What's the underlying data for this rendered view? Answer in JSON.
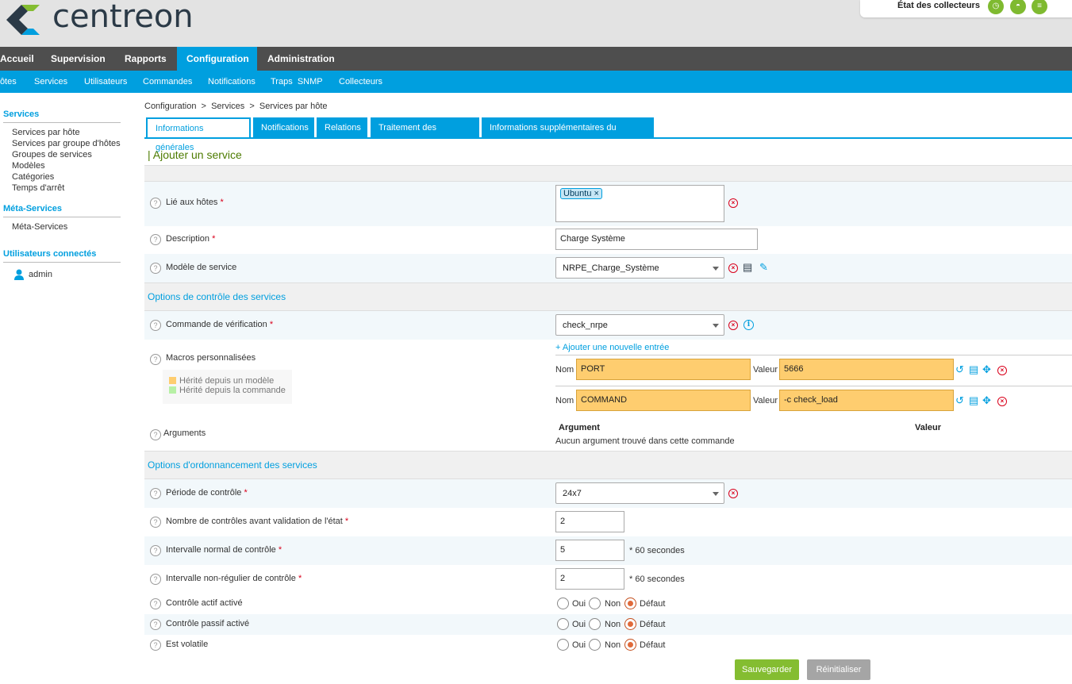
{
  "header": {
    "logo_text": "centreon",
    "collectors_label": "État des collecteurs"
  },
  "mainnav": [
    "Accueil",
    "Supervision",
    "Rapports",
    "Configuration",
    "Administration"
  ],
  "subnav": [
    "Hôtes",
    "Services",
    "Utilisateurs",
    "Commandes",
    "Notifications",
    "Traps  SNMP",
    "Collecteurs"
  ],
  "sidebar": {
    "services_title": "Services",
    "services_items": [
      "Services par hôte",
      "Services par groupe d'hôtes",
      "Groupes de services",
      "Modèles",
      "Catégories",
      "Temps d'arrêt"
    ],
    "meta_title": "Méta-Services",
    "meta_items": [
      "Méta-Services"
    ],
    "users_title": "Utilisateurs connectés",
    "user_name": "admin"
  },
  "breadcrumb": "Configuration  >  Services  >  Services par hôte",
  "tabs": [
    "Informations générales",
    "Notifications",
    "Relations",
    "Traitement des données",
    "Informations supplémentaires du service"
  ],
  "page_title": "| Ajouter un service",
  "form": {
    "hosts_label": "Lié aux hôtes",
    "hosts_tag": "Ubuntu",
    "description_label": "Description",
    "description_value": "Charge Système",
    "template_label": "Modèle de service",
    "template_value": "NRPE_Charge_Système",
    "section_control": "Options de contrôle des services",
    "check_cmd_label": "Commande de vérification",
    "check_cmd_value": "check_nrpe",
    "macros_label": "Macros personnalisées",
    "add_entry": "+ Ajouter une nouvelle entrée",
    "legend_template": "Hérité depuis un modèle",
    "legend_command": "Hérité depuis la commande",
    "name_label": "Nom",
    "value_label": "Valeur",
    "macros": [
      {
        "name": "PORT",
        "value": "5666"
      },
      {
        "name": "COMMAND",
        "value": "-c check_load"
      }
    ],
    "arguments_label": "Arguments",
    "arg_col_argument": "Argument",
    "arg_col_value": "Valeur",
    "arg_none": "Aucun argument trouvé dans cette commande",
    "section_scheduling": "Options d'ordonnancement des services",
    "period_label": "Période de contrôle",
    "period_value": "24x7",
    "max_checks_label": "Nombre de contrôles avant validation de l'état",
    "max_checks_value": "2",
    "normal_interval_label": "Intervalle normal de contrôle",
    "normal_interval_value": "5",
    "retry_interval_label": "Intervalle non-régulier de contrôle",
    "retry_interval_value": "2",
    "seconds_suffix": "* 60 secondes",
    "active_label": "Contrôle actif activé",
    "passive_label": "Contrôle passif activé",
    "volatile_label": "Est volatile",
    "radio_yes": "Oui",
    "radio_no": "Non",
    "radio_default": "Défaut",
    "required_mark": "*"
  },
  "buttons": {
    "save": "Sauvegarder",
    "reset": "Réinitialiser"
  },
  "colors": {
    "accent": "#009fdf",
    "nav_dark": "#4e4e4e",
    "save_green": "#84bd31",
    "reset_gray": "#a5a5a5",
    "macro_orange": "#fecd6f"
  }
}
